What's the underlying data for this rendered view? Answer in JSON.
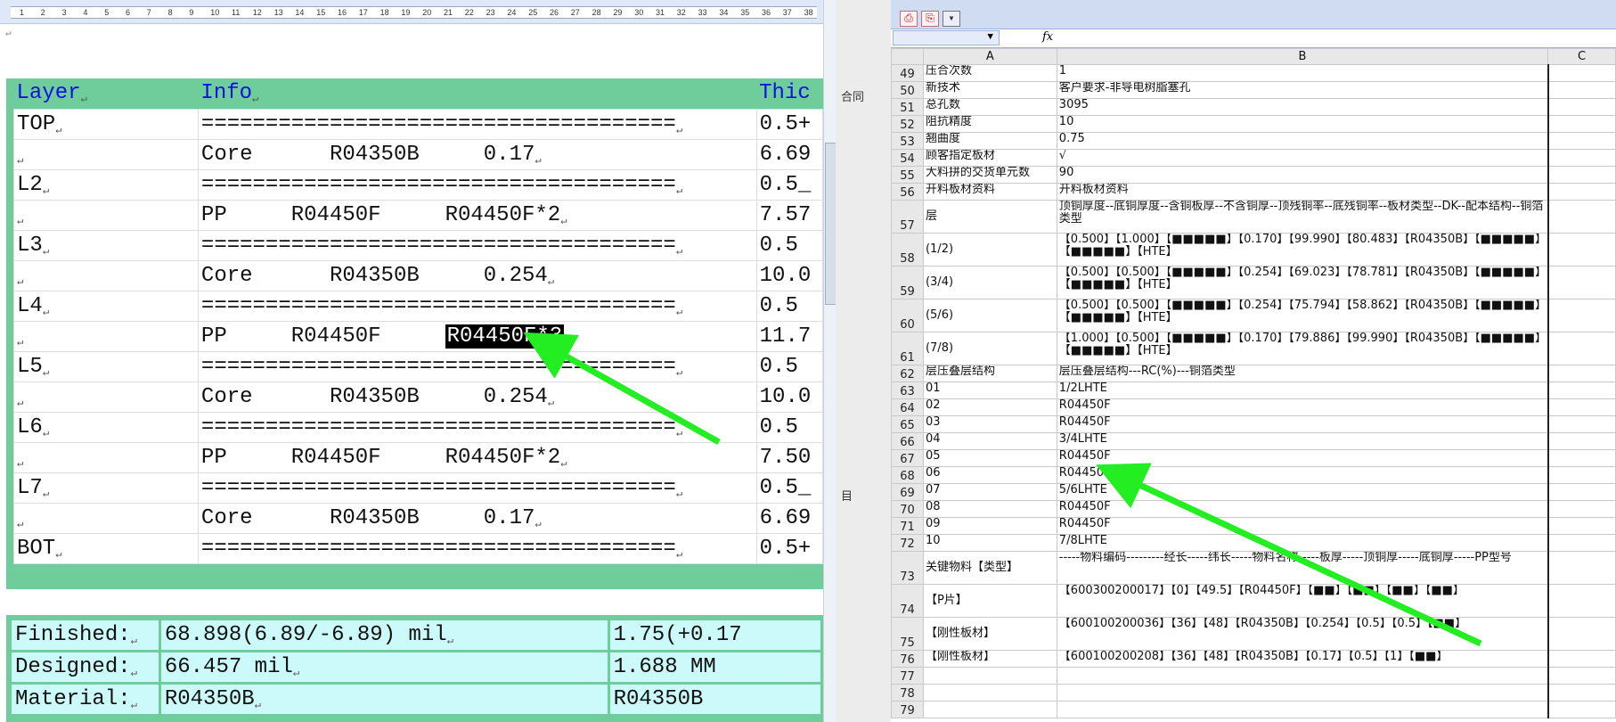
{
  "word": {
    "ruler_ticks": [
      "1",
      "2",
      "3",
      "4",
      "5",
      "6",
      "7",
      "8",
      "9",
      "10",
      "11",
      "12",
      "13",
      "14",
      "15",
      "16",
      "17",
      "18",
      "19",
      "20",
      "21",
      "22",
      "23",
      "24",
      "25",
      "26",
      "27",
      "28",
      "29",
      "30",
      "31",
      "32",
      "33",
      "34",
      "35",
      "36",
      "37",
      "38"
    ],
    "header": {
      "layer": "Layer",
      "info": "Info",
      "thickness": "Thic"
    },
    "rows": [
      {
        "layer": "TOP",
        "info": "=====================================",
        "thick": "0.5+"
      },
      {
        "layer": "",
        "info": "Core      R04350B     0.17",
        "thick": "6.69"
      },
      {
        "layer": "L2",
        "info": "=====================================",
        "thick": "0.5_"
      },
      {
        "layer": "",
        "info": "PP     R04450F     R04450F*2",
        "thick": "7.57"
      },
      {
        "layer": "L3",
        "info": "=====================================",
        "thick": "0.5"
      },
      {
        "layer": "",
        "info": "Core      R04350B     0.254",
        "thick": "10.0"
      },
      {
        "layer": "L4",
        "info": "=====================================",
        "thick": "0.5"
      },
      {
        "layer": "",
        "info": "PP     R04450F     ",
        "selected": "R04450F*3",
        "thick": "11.7"
      },
      {
        "layer": "L5",
        "info": "=====================================",
        "thick": "0.5"
      },
      {
        "layer": "",
        "info": "Core      R04350B     0.254",
        "thick": "10.0"
      },
      {
        "layer": "L6",
        "info": "=====================================",
        "thick": "0.5"
      },
      {
        "layer": "",
        "info": "PP     R04450F     R04450F*2",
        "thick": "7.50"
      },
      {
        "layer": "L7",
        "info": "=====================================",
        "thick": "0.5_"
      },
      {
        "layer": "",
        "info": "Core      R04350B     0.17",
        "thick": "6.69"
      },
      {
        "layer": "BOT",
        "info": "=====================================",
        "thick": "0.5+"
      }
    ],
    "summary": [
      {
        "label": "Finished:",
        "value": "68.898(6.89/-6.89) mil",
        "extra": "1.75(+0.17"
      },
      {
        "label": "Designed:",
        "value": "66.457 mil",
        "extra": "1.688 MM"
      },
      {
        "label": "Material:",
        "value": "R04350B",
        "extra": "R04350B"
      }
    ],
    "side_text_1": "合同",
    "side_text_2": "目"
  },
  "excel": {
    "columns": [
      "A",
      "B",
      "C"
    ],
    "rows": [
      {
        "n": "49",
        "a": "压合次数",
        "b": "1"
      },
      {
        "n": "50",
        "a": "新技术",
        "b": "客户要求-非导电树脂塞孔"
      },
      {
        "n": "51",
        "a": "总孔数",
        "b": "3095"
      },
      {
        "n": "52",
        "a": "阻抗精度",
        "b": "10"
      },
      {
        "n": "53",
        "a": "翘曲度",
        "b": "0.75"
      },
      {
        "n": "54",
        "a": "顾客指定板材",
        "b": "√"
      },
      {
        "n": "55",
        "a": "大料拼的交货单元数",
        "b": "90"
      },
      {
        "n": "56",
        "a": "开料板材资料",
        "b": "开料板材资料"
      },
      {
        "n": "57",
        "a": "层",
        "b": "顶铜厚度--底铜厚度--含铜板厚--不含铜厚--顶残铜率--底残铜率--板材类型--DK--配本结构--铜箔类型",
        "tall": true
      },
      {
        "n": "58",
        "a": "(1/2)",
        "b": "【0.500】【1.000】【■■■■■】【0.170】【99.990】【80.483】【R04350B】【■■■■■】【■■■■■】【HTE】",
        "tall": true
      },
      {
        "n": "59",
        "a": "(3/4)",
        "b": "【0.500】【0.500】【■■■■■】【0.254】【69.023】【78.781】【R04350B】【■■■■■】【■■■■■】【HTE】",
        "tall": true
      },
      {
        "n": "60",
        "a": "(5/6)",
        "b": "【0.500】【0.500】【■■■■■】【0.254】【75.794】【58.862】【R04350B】【■■■■■】【■■■■■】【HTE】",
        "tall": true
      },
      {
        "n": "61",
        "a": "(7/8)",
        "b": "【1.000】【0.500】【■■■■■】【0.170】【79.886】【99.990】【R04350B】【■■■■■】【■■■■■】【HTE】",
        "tall": true
      },
      {
        "n": "62",
        "a": "层压叠层结构",
        "b": "层压叠层结构---RC(%)---铜箔类型"
      },
      {
        "n": "63",
        "a": "01",
        "b": "1/2LHTE"
      },
      {
        "n": "64",
        "a": "02",
        "b": "R04450F"
      },
      {
        "n": "65",
        "a": "03",
        "b": "R04450F"
      },
      {
        "n": "66",
        "a": "04",
        "b": "3/4LHTE"
      },
      {
        "n": "67",
        "a": "05",
        "b": "R04450F"
      },
      {
        "n": "68",
        "a": "06",
        "b": "R04450F"
      },
      {
        "n": "69",
        "a": "07",
        "b": "5/6LHTE"
      },
      {
        "n": "70",
        "a": "08",
        "b": "R04450F"
      },
      {
        "n": "71",
        "a": "09",
        "b": "R04450F"
      },
      {
        "n": "72",
        "a": "10",
        "b": "7/8LHTE"
      },
      {
        "n": "73",
        "a": "关键物料【类型】",
        "b": "-----物料编码---------经长-----纬长-----物料名称-----板厚-----顶铜厚-----底铜厚-----PP型号",
        "tall": true
      },
      {
        "n": "74",
        "a": "【P片】",
        "b": "【600300200017】【0】【49.5】【R04450F】【■■】【■■】【■■】【■■】",
        "tall": true
      },
      {
        "n": "75",
        "a": "【刚性板材】",
        "b": "【600100200036】【36】【48】【R04350B】【0.254】【0.5】【0.5】【■■】",
        "tall": true
      },
      {
        "n": "76",
        "a": "【刚性板材】",
        "b": "【600100200208】【36】【48】【R04350B】【0.17】【0.5】【1】【■■】"
      },
      {
        "n": "77",
        "a": "",
        "b": ""
      },
      {
        "n": "78",
        "a": "",
        "b": ""
      },
      {
        "n": "79",
        "a": "",
        "b": ""
      }
    ],
    "fx_label": "fx",
    "namebox_arrow": "▼"
  },
  "colors": {
    "table_green": "#6fcd9c",
    "header_blue": "#1010e0",
    "summary_cyan": "#ccfafa",
    "arrow_green": "#22ee22"
  }
}
